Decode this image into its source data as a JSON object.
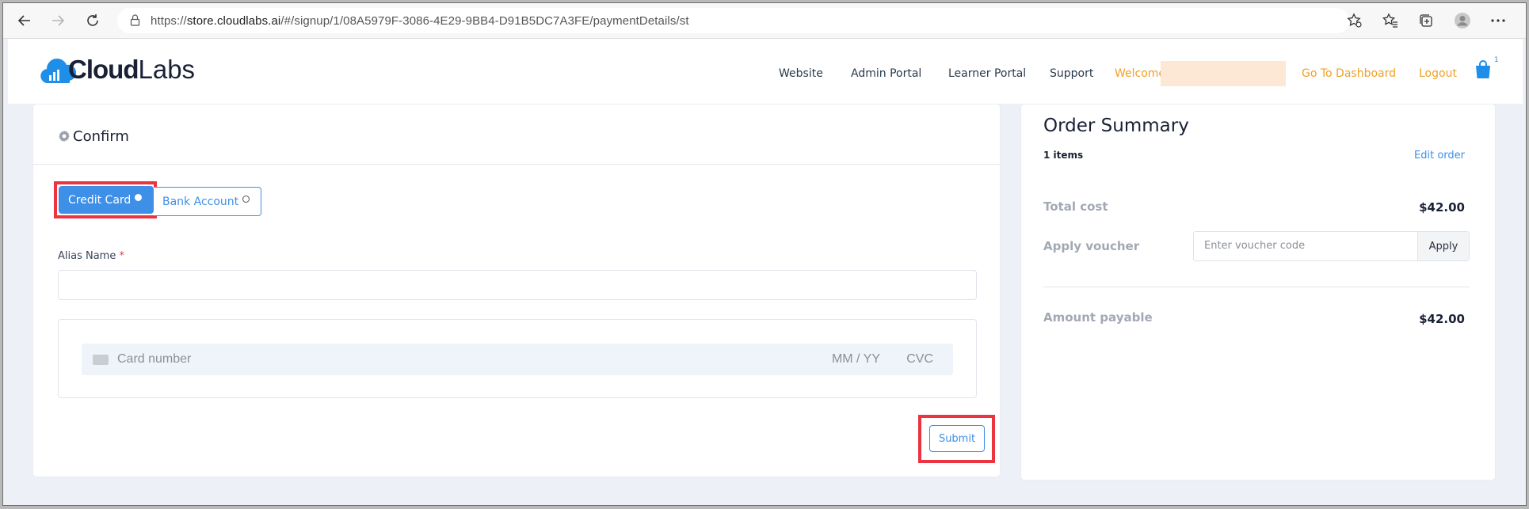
{
  "browser": {
    "url_prefix": "https://",
    "url_host": "store.cloudlabs.ai",
    "url_path": "/#/signup/1/08A5979F-3086-4E29-9BB4-D91B5DC7A3FE/paymentDetails/st"
  },
  "header": {
    "logo_bold": "Cloud",
    "logo_light": "Labs",
    "nav": {
      "website": "Website",
      "admin_portal": "Admin Portal",
      "learner_portal": "Learner Portal",
      "support": "Support",
      "welcome": "Welcome",
      "dashboard": "Go To Dashboard",
      "logout": "Logout"
    },
    "cart_count": "1"
  },
  "confirm": {
    "title": "Confirm",
    "credit_card_label": "Credit Card",
    "bank_account_label": "Bank Account",
    "alias_label": "Alias Name",
    "required_mark": "*",
    "card_number_placeholder": "Card number",
    "expiry_placeholder": "MM / YY",
    "cvc_placeholder": "CVC",
    "submit_label": "Submit"
  },
  "summary": {
    "title": "Order Summary",
    "items": "1 items",
    "edit_order": "Edit order",
    "total_cost_label": "Total cost",
    "total_cost_value": "$42.00",
    "apply_voucher_label": "Apply voucher",
    "voucher_placeholder": "Enter voucher code",
    "apply_label": "Apply",
    "amount_payable_label": "Amount payable",
    "amount_payable_value": "$42.00"
  },
  "colors": {
    "accent_blue": "#3d8fe8",
    "highlight_red": "#ec3340",
    "nav_orange": "#f0a026"
  }
}
